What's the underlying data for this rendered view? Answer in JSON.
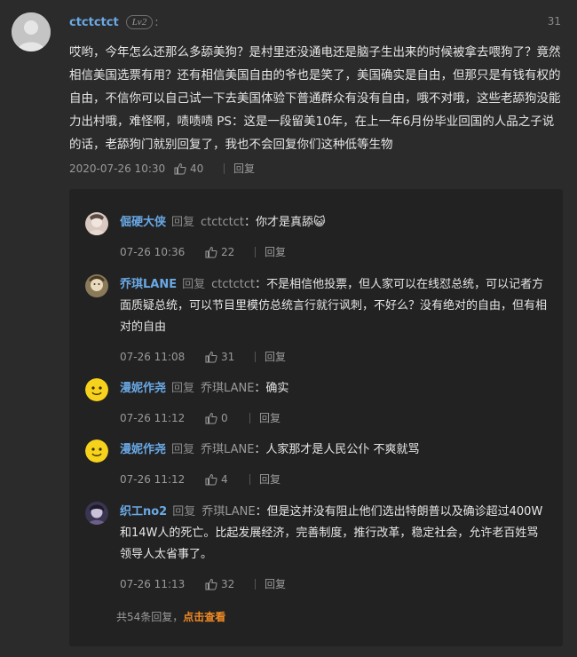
{
  "comment": {
    "username": "ctctctct",
    "level": "Lv2",
    "floor": "31",
    "text": "哎哟，今年怎么还那么多舔美狗？是村里还没通电还是脑子生出来的时候被拿去喂狗了？竟然相信美国选票有用？还有相信美国自由的爷也是笑了，美国确实是自由，但那只是有钱有权的自由，不信你可以自己试一下去美国体验下普通群众有没有自由，哦不对哦，这些老舔狗没能力出村哦，难怪啊，啧啧啧 PS：这是一段留美10年，在上一年6月份毕业回国的人品之子说的话，老舔狗门就别回复了，我也不会回复你们这种低等生物",
    "time": "2020-07-26 10:30",
    "likes": "40",
    "reply_label": "回复"
  },
  "replies": [
    {
      "user": "倔硬大侠",
      "reply_word": "回复",
      "target": "ctctctct",
      "text": "你才是真舔",
      "emoji": "😺",
      "time": "07-26 10:36",
      "likes": "22",
      "reply_label": "回复"
    },
    {
      "user": "乔琪LANE",
      "reply_word": "回复",
      "target": "ctctctct",
      "text": "不是相信他投票，但人家可以在线怼总统，可以记者方面质疑总统，可以节目里模仿总统言行就行讽刺，不好么？没有绝对的自由，但有相对的自由",
      "time": "07-26 11:08",
      "likes": "31",
      "reply_label": "回复"
    },
    {
      "user": "漫妮作尧",
      "reply_word": "回复",
      "target": "乔琪LANE",
      "text": "确实",
      "time": "07-26 11:12",
      "likes": "0",
      "reply_label": "回复"
    },
    {
      "user": "漫妮作尧",
      "reply_word": "回复",
      "target": "乔琪LANE",
      "text": "人家那才是人民公仆 不爽就骂",
      "time": "07-26 11:12",
      "likes": "4",
      "reply_label": "回复"
    },
    {
      "user": "织工no2",
      "reply_word": "回复",
      "target": "乔琪LANE",
      "text": "但是这并没有阻止他们选出特朗普以及确诊超过400W和14W人的死亡。比起发展经济，完善制度，推行改革，稳定社会，允许老百姓骂领导人太省事了。",
      "time": "07-26 11:13",
      "likes": "32",
      "reply_label": "回复"
    }
  ],
  "more": {
    "count_text": "共54条回复，",
    "link": "点击查看"
  },
  "colors": {
    "background": "#2b2b2b",
    "reply_box": "#222222",
    "username": "#6aa9e6",
    "link": "#f08a24"
  },
  "icons": {
    "like": "thumbs-up-icon",
    "avatar_default": "default-user-avatar"
  }
}
